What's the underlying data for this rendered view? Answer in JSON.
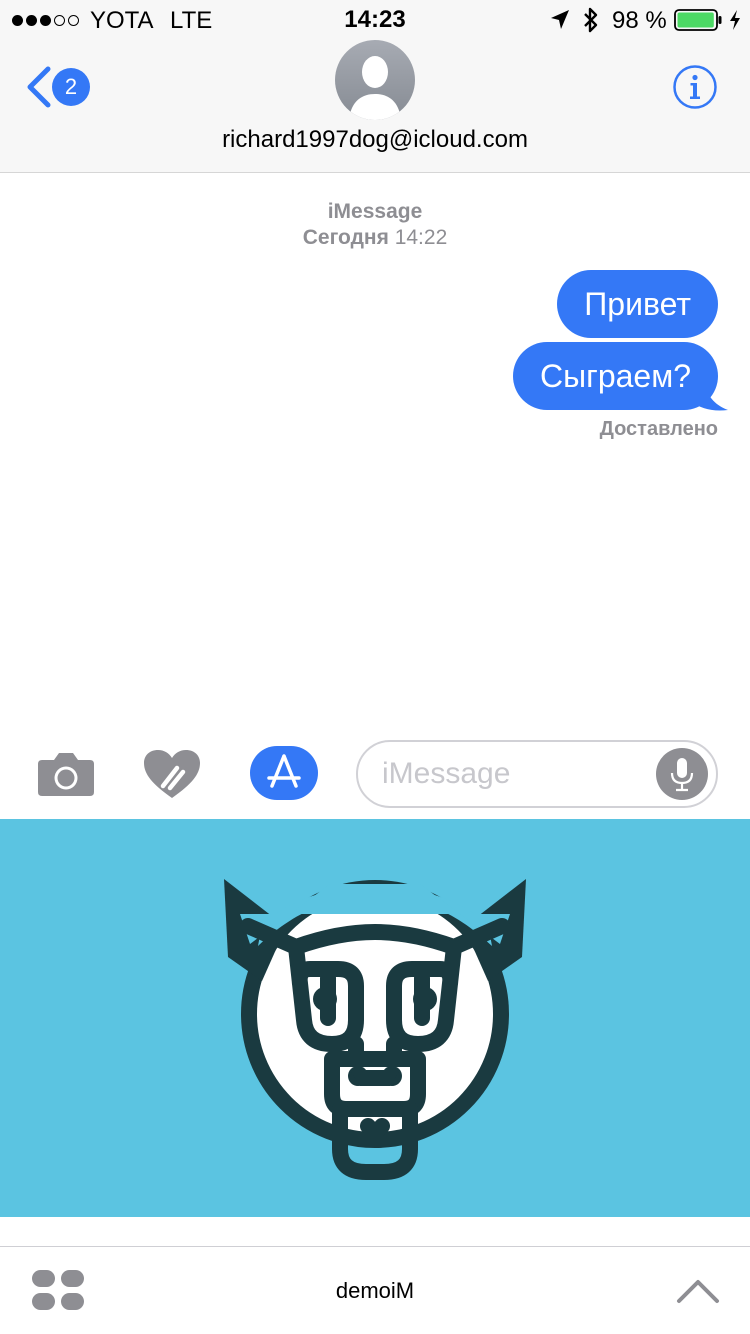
{
  "status_bar": {
    "carrier": "YOTA",
    "network": "LTE",
    "time": "14:23",
    "battery_percent": "98 %",
    "battery_level": 0.98,
    "signal_bars": 3,
    "signal_max": 5
  },
  "nav": {
    "unread_count": "2",
    "contact": "richard1997dog@icloud.com",
    "icons": {
      "back": "chevron-left-icon",
      "info": "info-icon",
      "avatar": "person-silhouette-icon"
    }
  },
  "thread": {
    "service": "iMessage",
    "timestamp_day": "Сегодня",
    "timestamp_time": "14:22",
    "messages": [
      {
        "text": "Привет",
        "direction": "outgoing"
      },
      {
        "text": "Сыграем?",
        "direction": "outgoing"
      }
    ],
    "delivery_status": "Доставлено"
  },
  "composer": {
    "placeholder": "iMessage",
    "icons": [
      "camera-icon",
      "digital-touch-heart-icon",
      "app-store-icon",
      "microphone-icon"
    ]
  },
  "app_drawer": {
    "background_color": "#5bc4e1",
    "logo": "bull-head-logo",
    "app_name": "demoiM",
    "icons": [
      "apps-grid-icon",
      "chevron-up-icon"
    ]
  },
  "colors": {
    "accent": "#3478f6",
    "secondary_text": "#8e8e93",
    "logo_dark": "#1a3a40"
  }
}
